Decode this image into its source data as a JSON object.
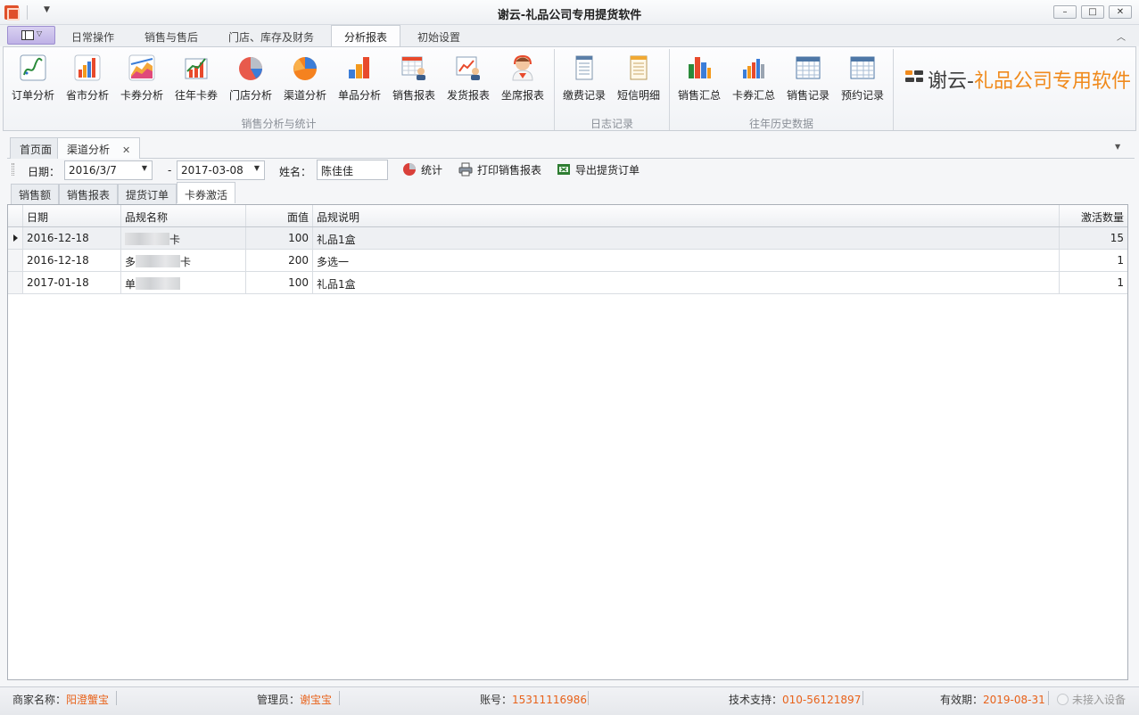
{
  "window": {
    "title": "谢云-礼品公司专用提货软件",
    "controls": {
      "minimize": "–",
      "maximize": "□",
      "close": "✕"
    }
  },
  "ribbon": {
    "tabs": [
      "日常操作",
      "销售与售后",
      "门店、库存及财务",
      "分析报表",
      "初始设置"
    ],
    "active_tab": "分析报表",
    "groups": [
      {
        "label": "销售分析与统计",
        "buttons": [
          "订单分析",
          "省市分析",
          "卡券分析",
          "往年卡券",
          "门店分析",
          "渠道分析",
          "单品分析",
          "销售报表",
          "发货报表",
          "坐席报表"
        ]
      },
      {
        "label": "日志记录",
        "buttons": [
          "缴费记录",
          "短信明细"
        ]
      },
      {
        "label": "往年历史数据",
        "buttons": [
          "销售汇总",
          "卡券汇总",
          "销售记录",
          "预约记录"
        ]
      }
    ],
    "brand": {
      "part1": "谢云-",
      "part2": "礼品公司专用软件"
    }
  },
  "doc_tabs": [
    {
      "label": "首页面"
    },
    {
      "label": "渠道分析",
      "close": "✕"
    }
  ],
  "toolbar": {
    "date_label": "日期：",
    "date_from": "2016/3/7",
    "dash": "-",
    "date_to": "2017-03-08",
    "name_label": "姓名：",
    "name_value": "陈佳佳",
    "stats_btn": "统计",
    "print_btn": "打印销售报表",
    "export_btn": "导出提货订单"
  },
  "sub_tabs": [
    "销售额",
    "销售报表",
    "提货订单",
    "卡券激活"
  ],
  "grid": {
    "columns": [
      "日期",
      "品规名称",
      "面值",
      "品规说明",
      "激活数量"
    ],
    "rows": [
      {
        "date": "2016-12-18",
        "name": "卡",
        "value": "100",
        "desc": "礼品1盒",
        "qty": "15"
      },
      {
        "date": "2016-12-18",
        "name": "多",
        "name_suffix": "卡",
        "value": "200",
        "desc": "多选一",
        "qty": "1"
      },
      {
        "date": "2017-01-18",
        "name": "单",
        "value": "100",
        "desc": "礼品1盒",
        "qty": "1"
      }
    ]
  },
  "statusbar": {
    "merchant_label": "商家名称：",
    "merchant": "阳澄蟹宝",
    "admin_label": "管理员：",
    "admin": "谢宝宝",
    "account_label": "账号：",
    "account": "15311116986",
    "support_label": "技术支持：",
    "support": "010-56121897",
    "expiry_label": "有效期：",
    "expiry": "2019-08-31",
    "device": "未接入设备"
  },
  "colors": {
    "accent_orange": "#e8621a",
    "brand_orange": "#f08a1c"
  }
}
